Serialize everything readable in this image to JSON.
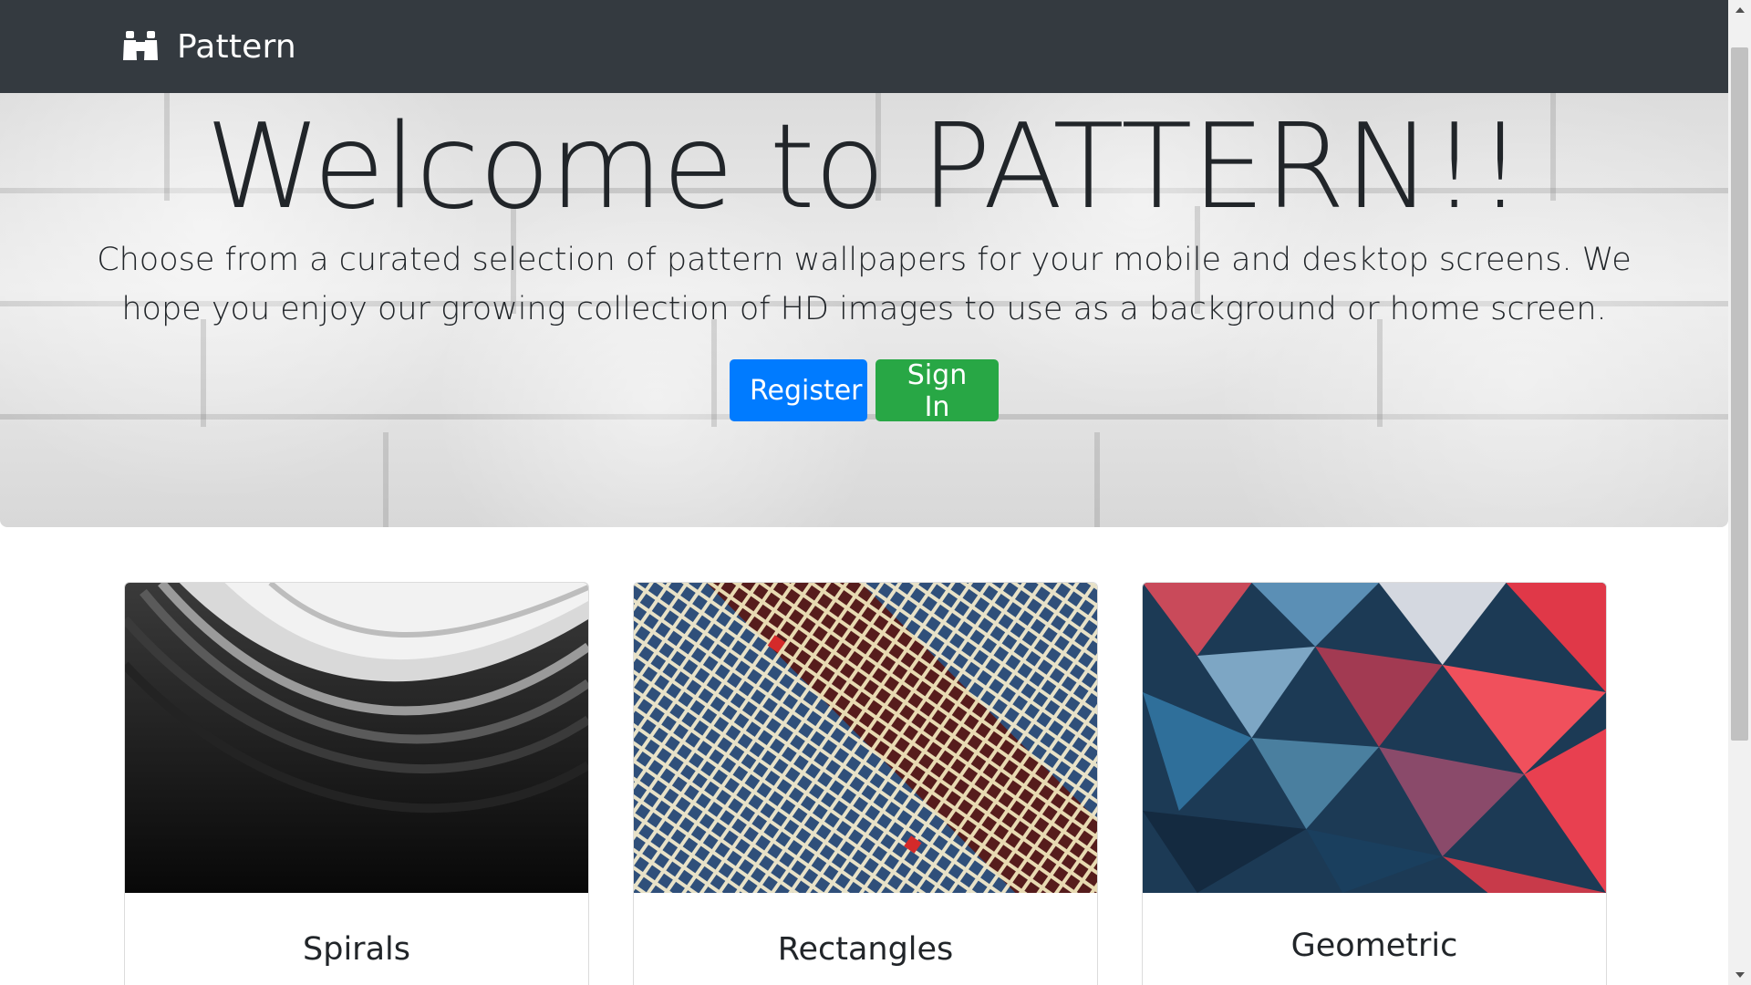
{
  "navbar": {
    "brand": "Pattern",
    "brand_icon": "binoculars-icon"
  },
  "hero": {
    "title": "Welcome to PATTERN!!",
    "lead": "Choose from a curated selection of pattern wallpapers for your mobile and desktop screens. We hope you enjoy our growing collection of HD images to use as a background or home screen.",
    "register_label": "Register",
    "signin_label": "Sign In"
  },
  "cards": [
    {
      "title": "Spirals"
    },
    {
      "title": "Rectangles"
    },
    {
      "title": "Geometric"
    }
  ],
  "colors": {
    "navbar_bg": "#343a40",
    "primary": "#007bff",
    "success": "#28a745"
  }
}
